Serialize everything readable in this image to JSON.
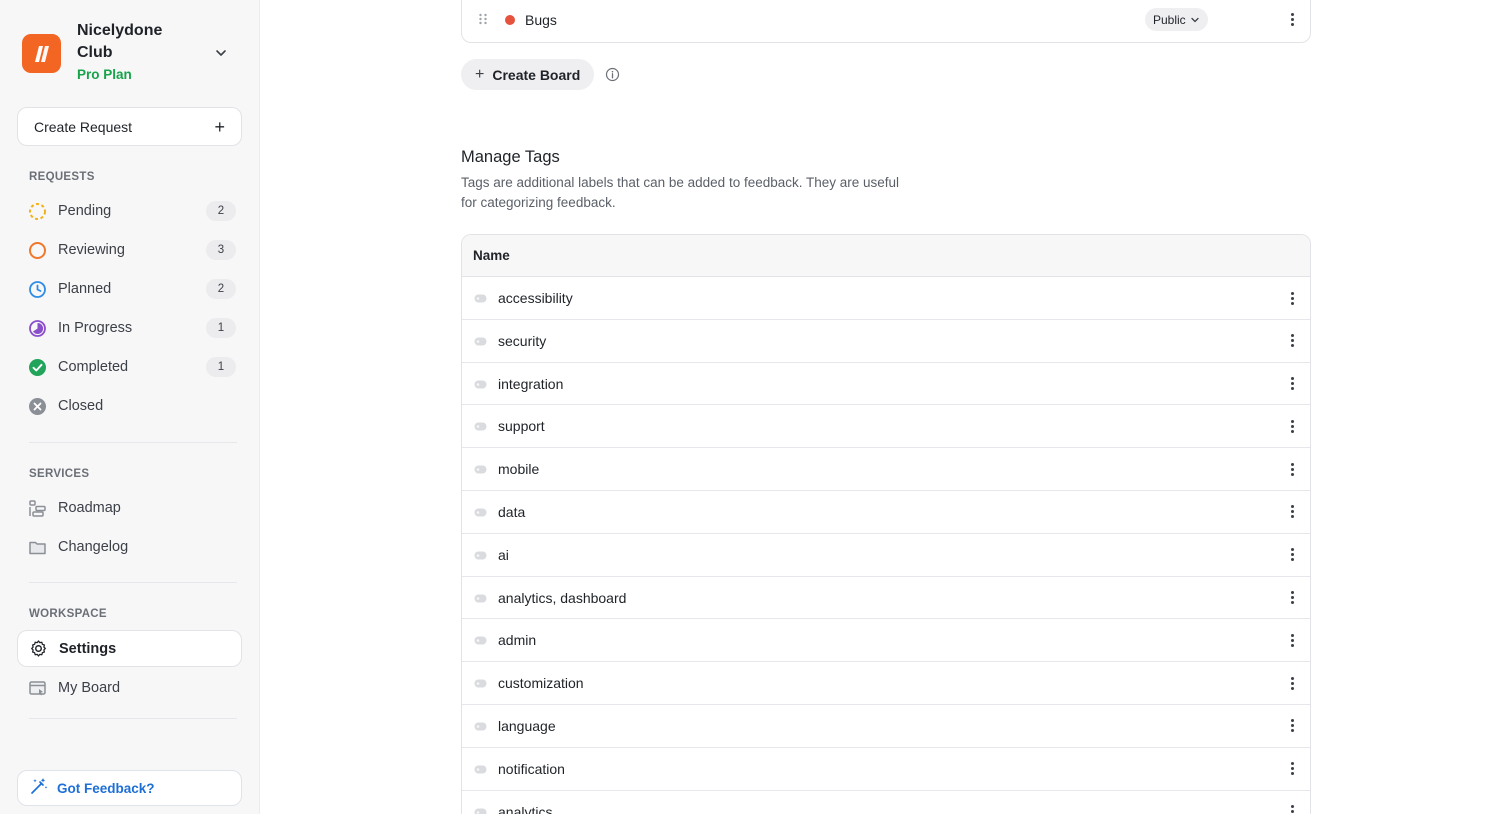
{
  "org": {
    "name": "Nicelydone Club",
    "plan": "Pro Plan"
  },
  "sidebar": {
    "create_request_label": "Create Request",
    "sections": {
      "requests": "REQUESTS",
      "services": "SERVICES",
      "workspace": "WORKSPACE"
    },
    "requests": [
      {
        "label": "Pending",
        "count": "2"
      },
      {
        "label": "Reviewing",
        "count": "3"
      },
      {
        "label": "Planned",
        "count": "2"
      },
      {
        "label": "In Progress",
        "count": "1"
      },
      {
        "label": "Completed",
        "count": "1"
      },
      {
        "label": "Closed"
      }
    ],
    "services": [
      {
        "label": "Roadmap"
      },
      {
        "label": "Changelog"
      }
    ],
    "workspace": [
      {
        "label": "Settings"
      },
      {
        "label": "My Board"
      }
    ],
    "feedback_label": "Got Feedback?"
  },
  "boards": {
    "row": {
      "name": "Bugs",
      "visibility": "Public",
      "dot_color": "#e5533d"
    },
    "create_label": "Create Board"
  },
  "tags": {
    "title": "Manage Tags",
    "description": "Tags are additional labels that can be added to feedback. They are useful for categorizing feedback.",
    "column_name": "Name",
    "rows": [
      "accessibility",
      "security",
      "integration",
      "support",
      "mobile",
      "data",
      "ai",
      "analytics, dashboard",
      "admin",
      "customization",
      "language",
      "notification",
      "analytics"
    ]
  },
  "colors": {
    "brand": "#f26522",
    "plan": "#16a34a",
    "feedback": "#1d6fd6"
  }
}
